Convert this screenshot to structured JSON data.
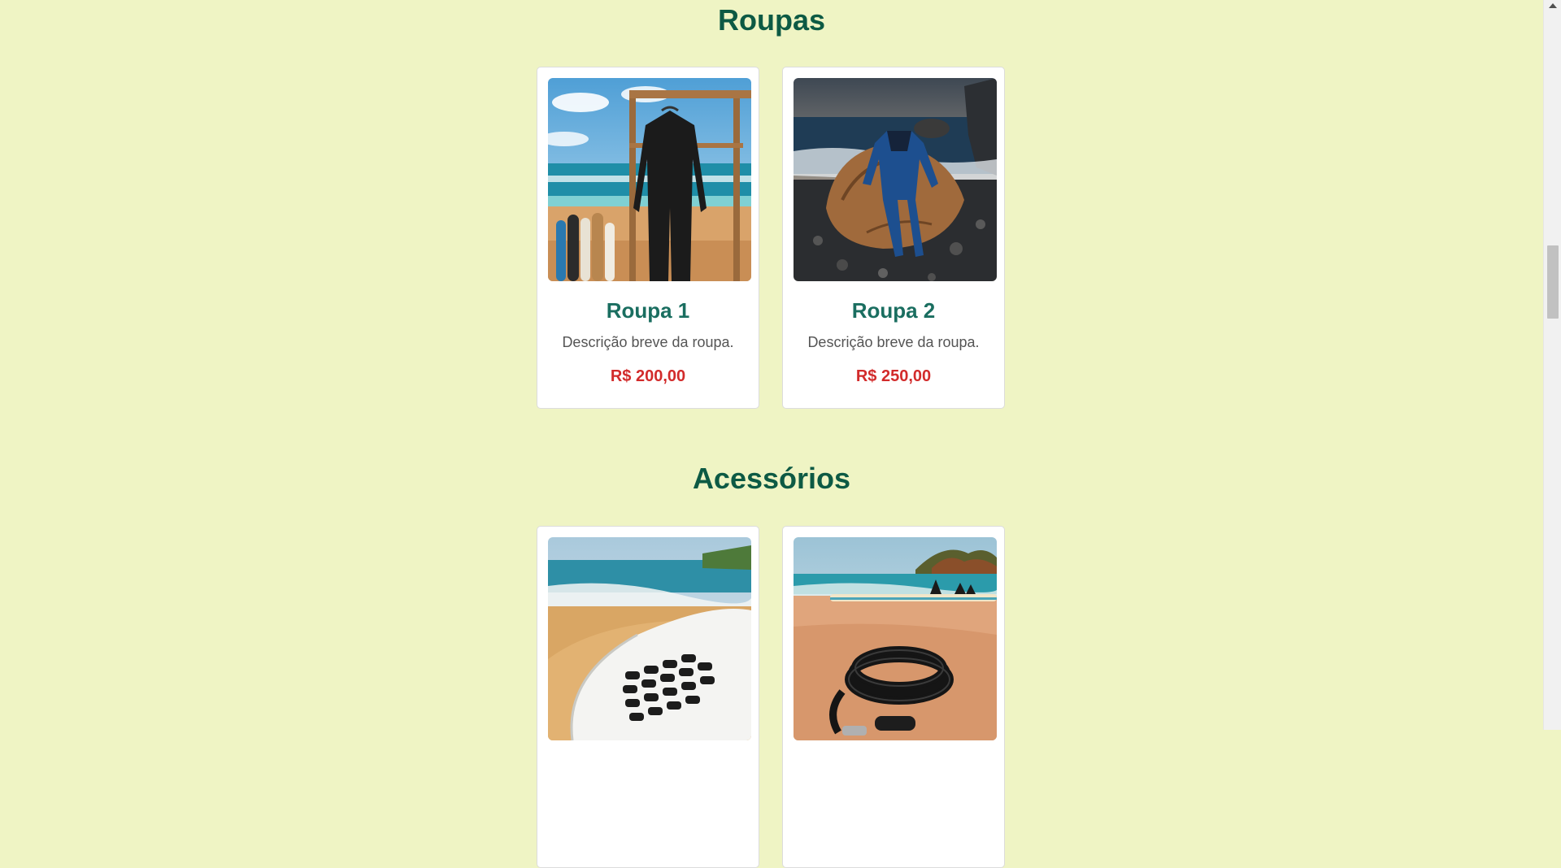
{
  "sections": [
    {
      "title": "Roupas",
      "products": [
        {
          "name": "Roupa 1",
          "description": "Descrição breve da roupa.",
          "price": "R$ 200,00",
          "image_icon": "wetsuit-on-beach-rack-image"
        },
        {
          "name": "Roupa 2",
          "description": "Descrição breve da roupa.",
          "price": "R$ 250,00",
          "image_icon": "wetsuit-on-rock-image"
        }
      ]
    },
    {
      "title": "Acessórios",
      "products": [
        {
          "image_icon": "surfboard-traction-pad-image"
        },
        {
          "image_icon": "surf-leash-on-sand-image"
        }
      ]
    }
  ],
  "scrollbar": {
    "position": 0.38
  },
  "colors": {
    "background": "#eff4c4",
    "section_title": "#0d5a44",
    "product_name": "#1a6e60",
    "price": "#d22b2b"
  }
}
